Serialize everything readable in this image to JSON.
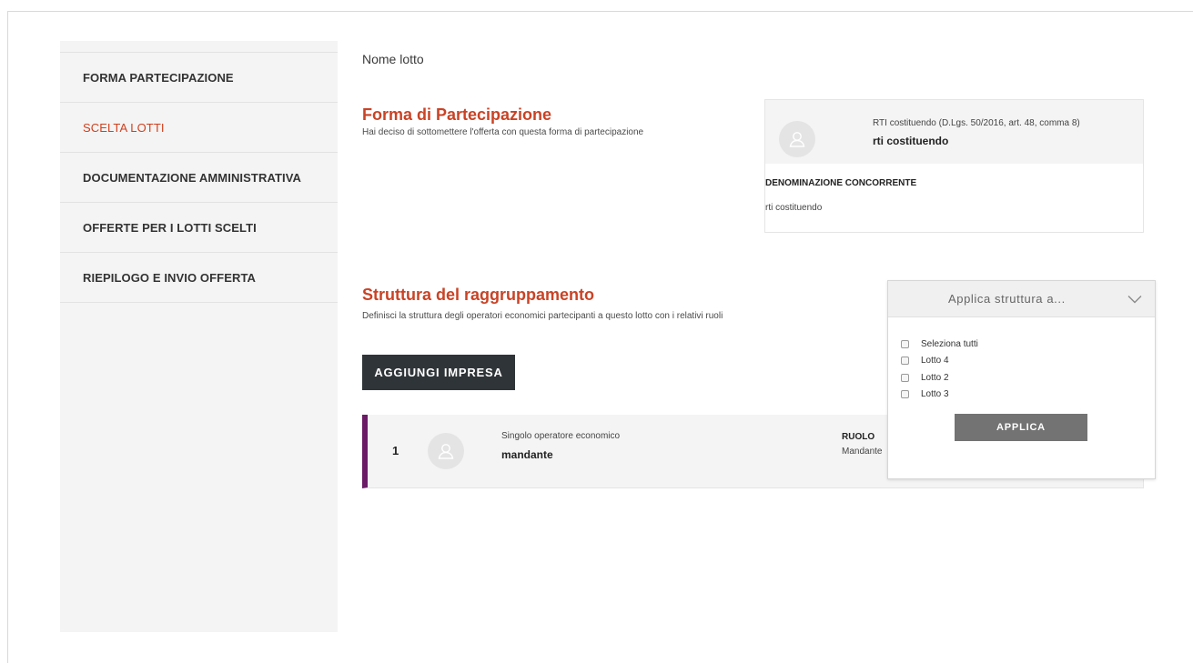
{
  "sidebar": {
    "items": [
      {
        "label": "FORMA PARTECIPAZIONE",
        "active": false
      },
      {
        "label": "SCELTA LOTTI",
        "active": true
      },
      {
        "label": "DOCUMENTAZIONE AMMINISTRATIVA",
        "active": false
      },
      {
        "label": "OFFERTE PER I LOTTI SCELTI",
        "active": false
      },
      {
        "label": "RIEPILOGO E INVIO OFFERTA",
        "active": false
      }
    ]
  },
  "main": {
    "lot_name": "Nome lotto",
    "participation": {
      "title": "Forma di Partecipazione",
      "description": "Hai deciso di sottomettere l'offerta con questa forma di partecipazione",
      "card": {
        "type_label": "RTI costituendo (D.Lgs. 50/2016, art. 48, comma 8)",
        "type_value": "rti costituendo",
        "denomination_label": "DENOMINAZIONE CONCORRENTE",
        "denomination_value": "rti costituendo"
      }
    },
    "structure": {
      "title": "Struttura del raggruppamento",
      "description": "Definisci la struttura degli operatori economici partecipanti a questo lotto con i relativi ruoli",
      "add_button": "AGGIUNGI IMPRESA",
      "members": [
        {
          "index": "1",
          "operator_type": "Singolo operatore economico",
          "name": "mandante",
          "role_label": "RUOLO",
          "role_value": "Mandante"
        }
      ]
    },
    "apply_dropdown": {
      "title": "Applica struttura a...",
      "options": [
        "Seleziona tutti",
        "Lotto 4",
        "Lotto 2",
        "Lotto 3"
      ],
      "apply_button": "APPLICA"
    }
  },
  "icons": {
    "avatar": "user-avatar-icon",
    "dropdown": "chevron-down-icon",
    "checkbox": "checkbox-icon"
  },
  "colors": {
    "accent_red": "#c94326",
    "member_bar": "#6b1b66",
    "dark_button": "#2f3438",
    "apply_button": "#737373"
  }
}
